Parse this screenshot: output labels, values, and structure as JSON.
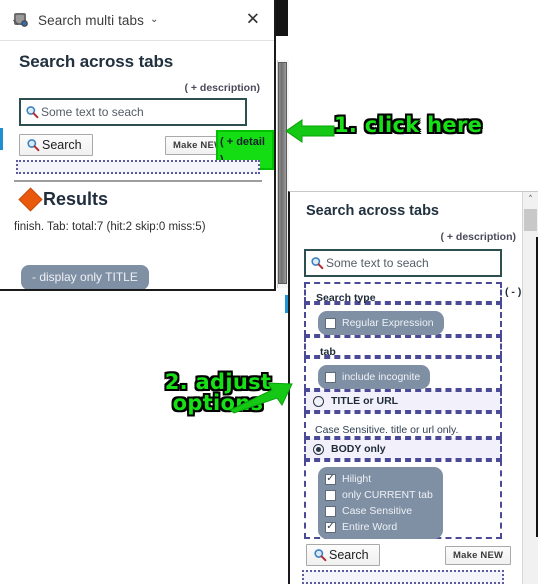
{
  "left_panel": {
    "titlebar": {
      "icon": "extension-icon",
      "title": "Search multi tabs",
      "caret": "⌄",
      "close": "✕"
    },
    "heading": "Search across tabs",
    "description_toggle": "( + description)",
    "search_input": {
      "icon": "search-icon",
      "value": "Some text to seach",
      "placeholder": "Some text to seach"
    },
    "search_button": "Search",
    "make_new_button": "Make NEW",
    "detail_toggle": "( + detail )",
    "results": {
      "icon": "orange-diamond-icon",
      "heading": "Results",
      "status": "finish. Tab: total:7 (hit:2 skip:0 miss:5)",
      "display_pill": "- display only TITLE"
    }
  },
  "right_panel": {
    "heading": "Search across tabs",
    "description_toggle": "( + description)",
    "search_input": {
      "icon": "search-icon",
      "value": "Some text to seach",
      "placeholder": "Some text to seach"
    },
    "sections": {
      "search_type_label": "Search type",
      "search_type_collapse": "( - )",
      "regular_expression": {
        "label": "Regular Expression",
        "checked": false
      },
      "tab_label": "tab",
      "include_incognito": {
        "label": "include incognite",
        "checked": false
      },
      "title_or_url": {
        "label": "TITLE or URL",
        "selected": false
      },
      "case_note": "Case Sensitive. title or url only.",
      "body_only": {
        "label": "BODY only",
        "selected": true
      },
      "body_options": [
        {
          "label": "Hilight",
          "checked": true
        },
        {
          "label": "only CURRENT tab",
          "checked": false
        },
        {
          "label": "Case Sensitive",
          "checked": false
        },
        {
          "label": "Entire Word",
          "checked": true
        }
      ]
    },
    "search_button": "Search",
    "make_new_button": "Make NEW",
    "scrollbar": {
      "up_arrow": "˄"
    }
  },
  "annotations": [
    {
      "id": "step-1",
      "text": "1. click here",
      "arrow": "arrow-left"
    },
    {
      "id": "step-2",
      "text": "2. adjust\noptions",
      "line1": "2. adjust",
      "line2": "options",
      "arrow": "arrow-right"
    }
  ],
  "colors": {
    "annotation_green": "#16e016",
    "annotation_outline": "#000000",
    "highlight_green": "#14dd14",
    "input_border": "#2e4f4f",
    "dashed_purple": "#4a4a96",
    "chip_gray": "#7f8fa4",
    "diamond_orange": "#e8590c",
    "panel_border": "#1a1a1a"
  }
}
